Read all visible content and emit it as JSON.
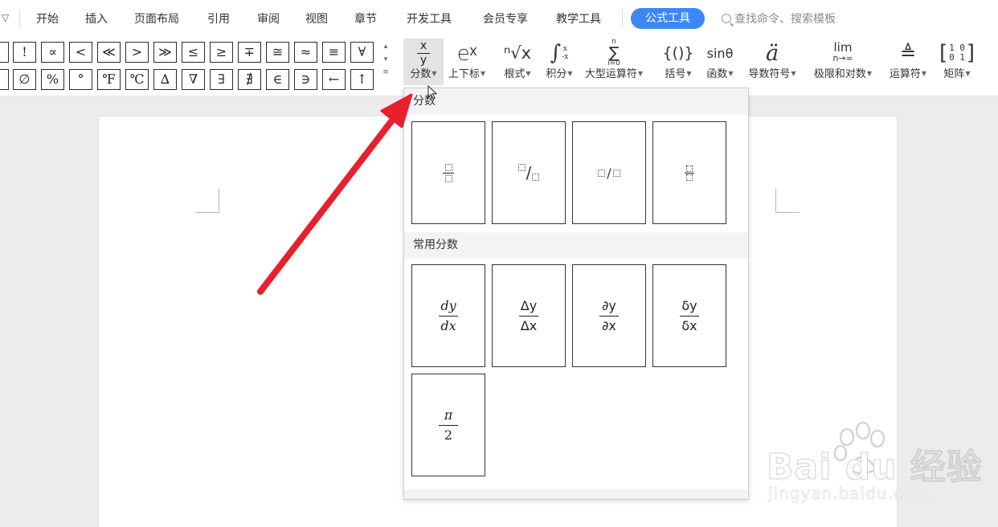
{
  "menu": {
    "collapse_glyph": "▽",
    "items": [
      "开始",
      "插入",
      "页面布局",
      "引用",
      "审阅",
      "视图",
      "章节",
      "开发工具",
      "会员专享",
      "教学工具"
    ],
    "active_tab": "公式工具",
    "search_placeholder": "查找命令、搜索模板"
  },
  "symbols": {
    "row1": [
      "!",
      "∝",
      "<",
      "≪",
      ">",
      "≫",
      "≤",
      "≥",
      "∓",
      "≅",
      "≈",
      "≡",
      "∀"
    ],
    "row2": [
      "∅",
      "%",
      "°",
      "℉",
      "℃",
      "∆",
      "∇",
      "∃",
      "∄",
      "∈",
      "∋",
      "←",
      "↑"
    ]
  },
  "tools": [
    {
      "label": "分数",
      "icon": "fraction-icon",
      "glyph_top": "x",
      "glyph_bottom": "y"
    },
    {
      "label": "上下标",
      "icon": "script-icon",
      "glyph": "eˣ"
    },
    {
      "label": "根式",
      "icon": "radical-icon",
      "glyph": "ⁿ√x"
    },
    {
      "label": "积分",
      "icon": "integral-icon",
      "glyph": "∫"
    },
    {
      "label": "大型运算符",
      "icon": "large-operator-icon",
      "glyph": "∑"
    },
    {
      "label": "括号",
      "icon": "bracket-icon",
      "glyph": "{()}"
    },
    {
      "label": "函数",
      "icon": "function-icon",
      "glyph": "sinθ"
    },
    {
      "label": "导数符号",
      "icon": "accent-icon",
      "glyph": "ä"
    },
    {
      "label": "极限和对数",
      "icon": "limit-log-icon",
      "glyph": "lim",
      "sub": "n→∞"
    },
    {
      "label": "运算符",
      "icon": "operator-icon",
      "glyph": "≜"
    },
    {
      "label": "矩阵",
      "icon": "matrix-icon",
      "glyph": "[10 01]"
    }
  ],
  "dropdown": {
    "section1_title": "分数",
    "section2_title": "常用分数",
    "common": [
      {
        "num": "dy",
        "den": "dx"
      },
      {
        "num": "Δy",
        "den": "Δx"
      },
      {
        "num": "∂y",
        "den": "∂x"
      },
      {
        "num": "δy",
        "den": "δx"
      },
      {
        "num": "π",
        "den": "2"
      }
    ]
  },
  "watermark": {
    "brand": "Bai du 经验",
    "url": "jingyan.baidu.com"
  },
  "colors": {
    "accent": "#3d87f5",
    "arrow": "#e8202d"
  }
}
